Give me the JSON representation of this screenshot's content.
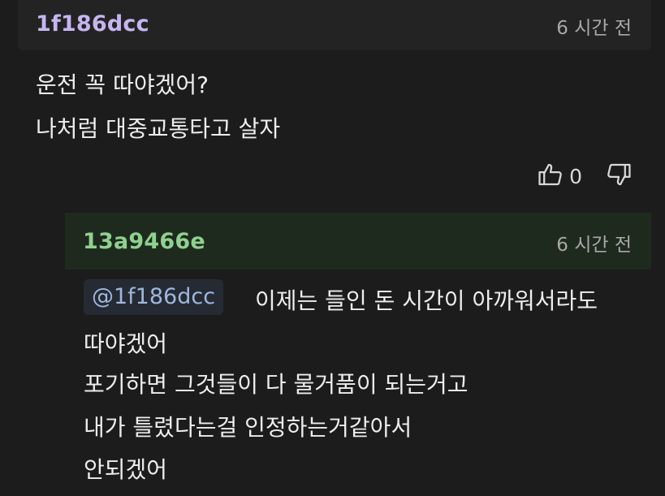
{
  "comment": {
    "username": "1f186dcc",
    "time": "6 시간 전",
    "lines": [
      "운전 꼭 따야겠어?",
      "나처럼 대중교통타고 살자"
    ],
    "like_count": "0",
    "icons": {
      "like": "thumbs-up-icon",
      "dislike": "thumbs-down-icon"
    }
  },
  "reply": {
    "username": "13a9466e",
    "time": "6 시간 전",
    "mention": "@1f186dcc",
    "first_line": "이제는 들인 돈 시간이 아까워서라도",
    "lines": [
      "따야겠어",
      "포기하면 그것들이 다 물거품이 되는거고",
      "내가 틀렸다는걸 인정하는거같아서",
      "안되겠어"
    ]
  },
  "colors": {
    "background": "#1c1c1c",
    "comment_username": "#c5b6f0",
    "reply_username": "#8fd18f",
    "reply_header_bg": "#1f2a1f",
    "mention": "#9eb7dd"
  }
}
